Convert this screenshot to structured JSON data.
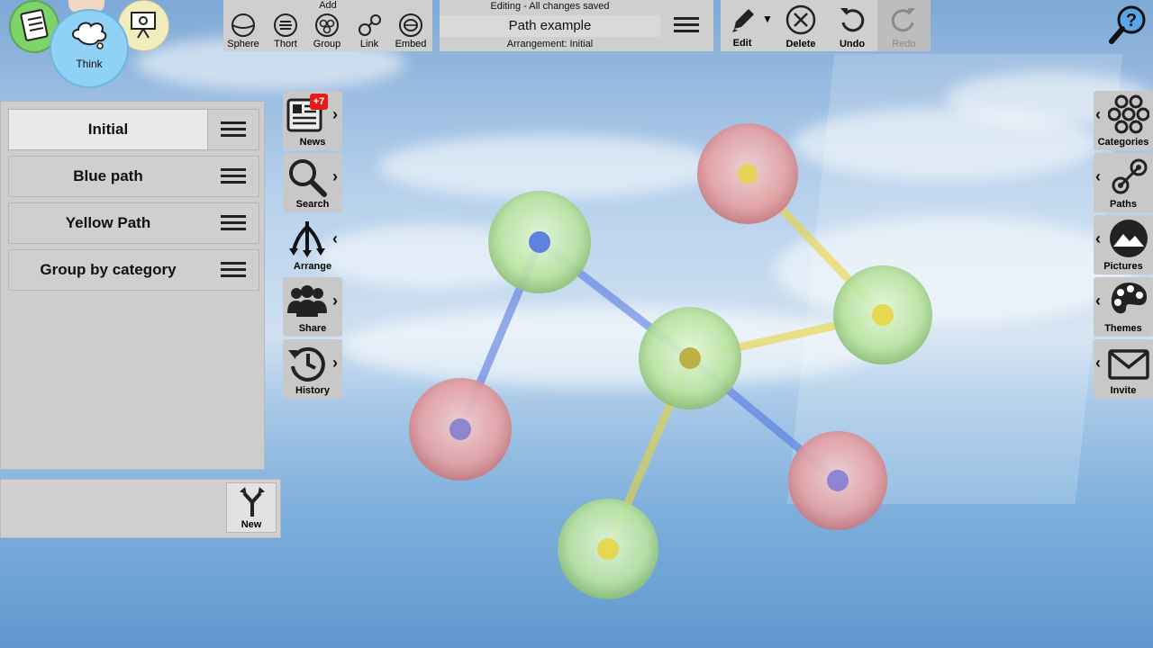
{
  "modes": {
    "think_label": "Think"
  },
  "add_toolbar": {
    "title": "Add",
    "buttons": [
      {
        "label": "Sphere",
        "icon": "sphere-icon"
      },
      {
        "label": "Thort",
        "icon": "thort-icon"
      },
      {
        "label": "Group",
        "icon": "group-icon"
      },
      {
        "label": "Link",
        "icon": "link-icon"
      },
      {
        "label": "Embed",
        "icon": "embed-icon"
      }
    ]
  },
  "document": {
    "status": "Editing - All changes saved",
    "title": "Path example",
    "arrangement": "Arrangement: Initial"
  },
  "edit_toolbar": {
    "edit": "Edit",
    "delete": "Delete",
    "undo": "Undo",
    "redo": "Redo"
  },
  "arrangements": [
    {
      "name": "Initial",
      "selected": true
    },
    {
      "name": "Blue path",
      "selected": false
    },
    {
      "name": "Yellow Path",
      "selected": false
    },
    {
      "name": "Group by category",
      "selected": false
    }
  ],
  "new_button": "New",
  "left_tools": [
    {
      "label": "News",
      "icon": "news-icon",
      "badge": "+7"
    },
    {
      "label": "Search",
      "icon": "search-icon"
    },
    {
      "label": "Arrange",
      "icon": "arrange-icon"
    },
    {
      "label": "Share",
      "icon": "share-icon"
    },
    {
      "label": "History",
      "icon": "history-icon"
    }
  ],
  "right_tools": [
    {
      "label": "Categories",
      "icon": "categories-icon"
    },
    {
      "label": "Paths",
      "icon": "paths-icon"
    },
    {
      "label": "Pictures",
      "icon": "pictures-icon"
    },
    {
      "label": "Themes",
      "icon": "themes-icon"
    },
    {
      "label": "Invite",
      "icon": "invite-icon"
    }
  ],
  "colors": {
    "green_sphere": "#bde8a6",
    "red_sphere": "#e6a5a8",
    "blue_path": "#4a6fe0",
    "yellow_path": "#e8d43a",
    "panel_gray": "#d2d2d2"
  }
}
